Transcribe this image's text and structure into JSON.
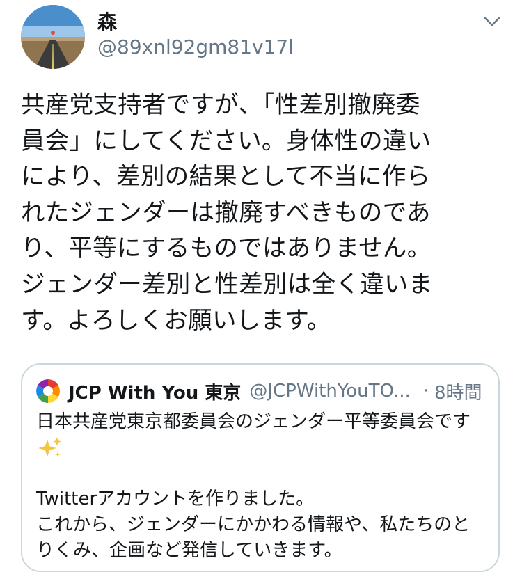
{
  "tweet": {
    "display_name": "森",
    "handle": "@89xnl92gm81v17l",
    "text": "共産党支持者ですが、「性差別撤廃委\n員会」にしてください。身体性の違い\nにより、差別の結果として不当に作ら\nれたジェンダーは撤廃すべきものであ\nり、平等にするものではありません。\nジェンダー差別と性差別は全く違いま\nす。よろしくお願いします。"
  },
  "quoted_tweet": {
    "name": "JCP With You 東京",
    "handle": "@JCPWithYouTO...",
    "separator": "·",
    "time": "8時間",
    "lines": [
      "日本共産党東京都委員会のジェンダー平等委員会です",
      "",
      "",
      "Twitterアカウントを作りました。",
      "これから、ジェンダーにかかわる情報や、私たちのと",
      "りくみ、企画など発信していきます。"
    ],
    "emoji": "sparkles-icon"
  },
  "colors": {
    "text": "#14171a",
    "secondary": "#657786",
    "border": "#ccd6dd",
    "sparkle": "#f5c542"
  }
}
